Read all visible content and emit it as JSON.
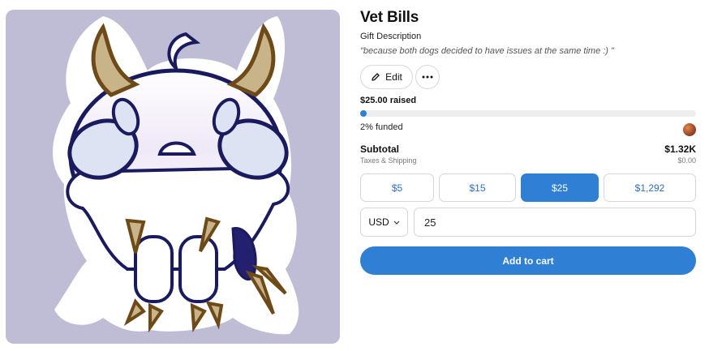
{
  "product": {
    "title": "Vet Bills",
    "description_label": "Gift Description",
    "description": "\"because both dogs decided to have issues at the same time :) \""
  },
  "actions": {
    "edit_label": "Edit",
    "edit_icon": "pencil-icon",
    "more_icon": "ellipsis-icon"
  },
  "funding": {
    "raised_text": "$25.00 raised",
    "funded_text": "2% funded",
    "progress_fraction": 0.02,
    "accent_color": "#2f7fd4"
  },
  "summary": {
    "subtotal_label": "Subtotal",
    "subtotal_value": "$1.32K",
    "tax_label": "Taxes & Shipping",
    "tax_value": "$0.00"
  },
  "amounts": {
    "options": [
      "$5",
      "$15",
      "$25",
      "$1,292"
    ],
    "selected": "$25"
  },
  "currency": {
    "selected": "USD",
    "chevron_icon": "chevron-down-icon"
  },
  "amount_input": {
    "value": "25"
  },
  "cart": {
    "label": "Add to cart"
  }
}
